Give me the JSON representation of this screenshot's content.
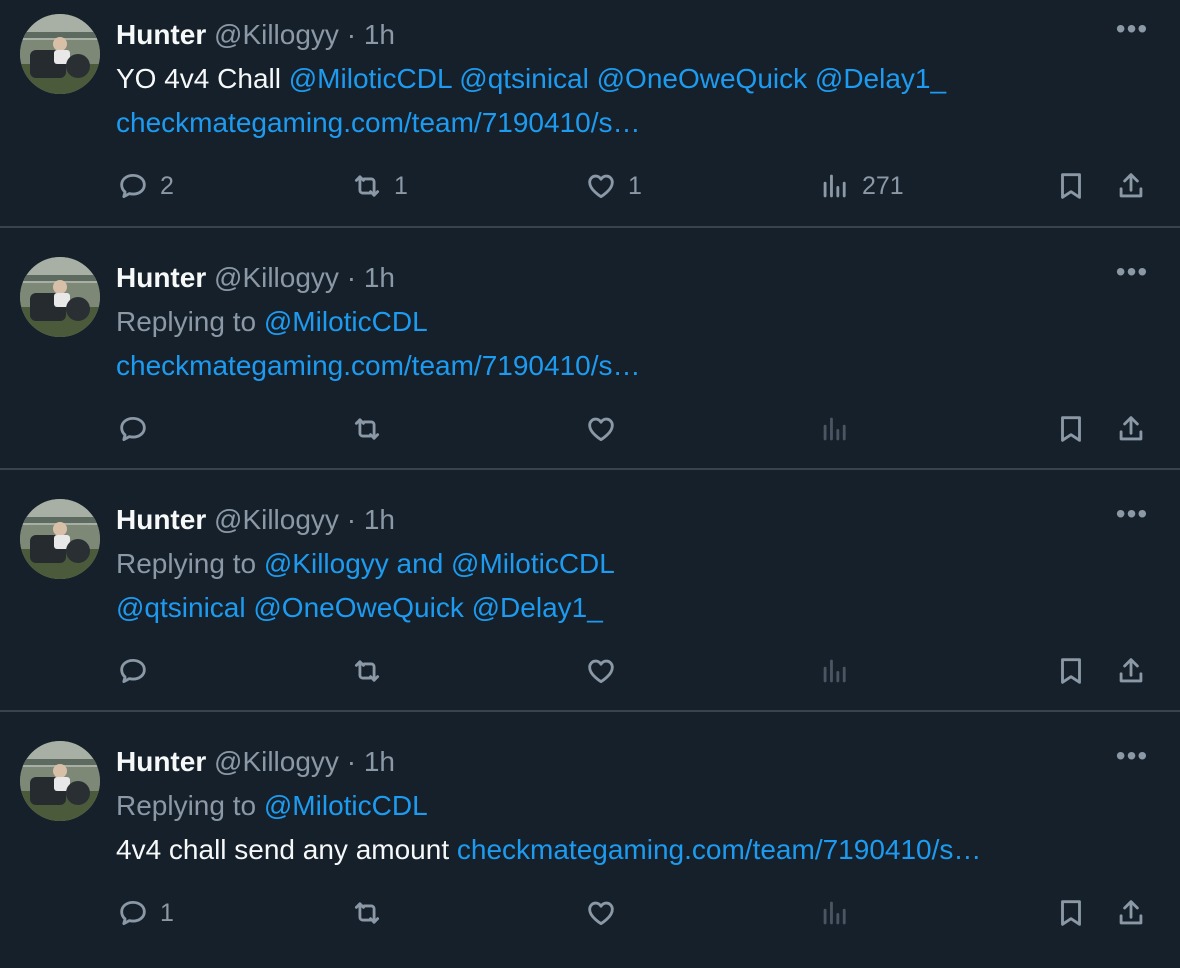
{
  "tweets": [
    {
      "name": "Hunter",
      "handle": "@Killogyy",
      "dot": "·",
      "time": "1h",
      "line1": [
        {
          "text": "YO 4v4 Chall ",
          "kind": "txt"
        },
        {
          "text": "@MiloticCDL @qtsinical @OneOweQuick @Delay1_",
          "kind": "link"
        }
      ],
      "line2": [
        {
          "text": "checkmategaming.com/team/7190410/s…",
          "kind": "link"
        }
      ],
      "replies": "2",
      "retweets": "1",
      "likes": "1",
      "views": "271",
      "views_active": true
    },
    {
      "name": "Hunter",
      "handle": "@Killogyy",
      "dot": "·",
      "time": "1h",
      "line1": [
        {
          "text": "Replying to ",
          "kind": "muted"
        },
        {
          "text": "@MiloticCDL",
          "kind": "link"
        }
      ],
      "line2": [
        {
          "text": "checkmategaming.com/team/7190410/s…",
          "kind": "link"
        }
      ],
      "replies": "",
      "retweets": "",
      "likes": "",
      "views": "",
      "views_active": false
    },
    {
      "name": "Hunter",
      "handle": "@Killogyy",
      "dot": "·",
      "time": "1h",
      "line1": [
        {
          "text": "Replying to ",
          "kind": "muted"
        },
        {
          "text": "@Killogyy and @MiloticCDL",
          "kind": "link"
        }
      ],
      "line2": [
        {
          "text": "@qtsinical @OneOweQuick @Delay1_",
          "kind": "link"
        }
      ],
      "replies": "",
      "retweets": "",
      "likes": "",
      "views": "",
      "views_active": false
    },
    {
      "name": "Hunter",
      "handle": "@Killogyy",
      "dot": "·",
      "time": "1h",
      "line1": [
        {
          "text": "Replying to ",
          "kind": "muted"
        },
        {
          "text": "@MiloticCDL",
          "kind": "link"
        }
      ],
      "line2": [
        {
          "text": "4v4 chall send any amount ",
          "kind": "txt"
        },
        {
          "text": "checkmategaming.com/team/7190410/s…",
          "kind": "link"
        }
      ],
      "replies": "1",
      "retweets": "",
      "likes": "",
      "views": "",
      "views_active": false
    }
  ],
  "icons": {
    "reply": "reply-icon",
    "retweet": "retweet-icon",
    "like": "heart-icon",
    "views": "views-icon",
    "bookmark": "bookmark-icon",
    "share": "share-icon",
    "more": "more-icon"
  },
  "colors": {
    "background": "#15202b",
    "divider": "#38444d",
    "text": "#f7f9f9",
    "muted": "#8b98a5",
    "link": "#1d9bf0",
    "dim_icon": "#4a5562"
  },
  "more_label": "•••"
}
